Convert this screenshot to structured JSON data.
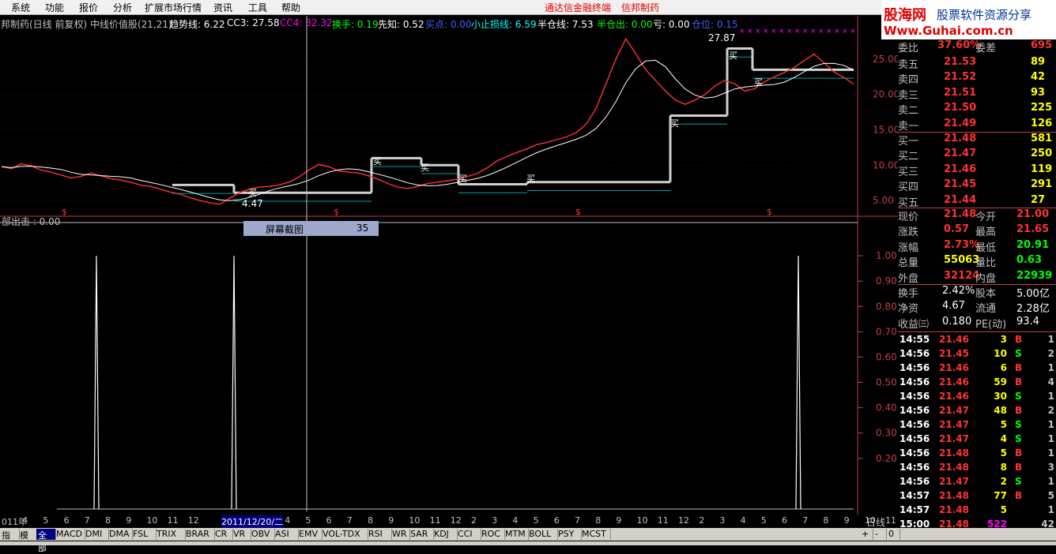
{
  "menu": [
    "系统",
    "功能",
    "报价",
    "分析",
    "扩展市场行情",
    "资讯",
    "工具",
    "帮助"
  ],
  "banner": [
    "通达信金融终端",
    "信邦制药"
  ],
  "logo": {
    "brand": "股海网",
    "tagline": "股票软件资源分享",
    "url": "Www.Guhai.com.cn"
  },
  "info": {
    "stock": "邦制药(日线 前复权) 中线价值股(21,21)",
    "trend": "趋势线: 6.22",
    "cc3": "CC3: 27.58",
    "cc4": "CC4: 32.32",
    "turnover": "换手: 0.19",
    "xianzhi": "先知: 0.52",
    "buy": "买点: 0.00",
    "stoploss": "小止损线: 6.59",
    "halfpos": "半仓线: 7.53",
    "halfout": "半仓出: 0.00",
    "loss": "亏: 0.00",
    "position": "仓位: 0.15"
  },
  "price_axis": {
    "ticks": [
      "25.00",
      "20.00",
      "15.00",
      "10.00",
      "5.00"
    ],
    "values": [
      25,
      20,
      15,
      10,
      5
    ]
  },
  "ind_axis": {
    "ticks": [
      "1.00",
      "0.90",
      "0.80",
      "0.70",
      "0.60",
      "0.50",
      "0.40",
      "0.30",
      "0.20"
    ]
  },
  "annotations": {
    "high": "27.87",
    "low": "4.47",
    "buy_label": "买",
    "dollar": "$"
  },
  "indicator_title": "部出击 : 0.00",
  "popup": {
    "label": "屏幕截图",
    "value": "35"
  },
  "colors": {
    "up": "#ff3232",
    "down": "#00ffff",
    "white": "#ffffff",
    "yellow": "#ffff00",
    "green": "#00ff00",
    "magenta": "#ff00ff",
    "blue": "#4060ff"
  },
  "panel": {
    "weibi": {
      "label": "委比",
      "value": "37.60%",
      "label2": "委差",
      "value2": "695"
    },
    "asks": [
      {
        "label": "卖五",
        "price": "21.53",
        "vol": "89"
      },
      {
        "label": "卖四",
        "price": "21.52",
        "vol": "42"
      },
      {
        "label": "卖三",
        "price": "21.51",
        "vol": "93"
      },
      {
        "label": "卖二",
        "price": "21.50",
        "vol": "225"
      },
      {
        "label": "卖一",
        "price": "21.49",
        "vol": "126"
      }
    ],
    "bids": [
      {
        "label": "买一",
        "price": "21.48",
        "vol": "581"
      },
      {
        "label": "买二",
        "price": "21.47",
        "vol": "250"
      },
      {
        "label": "买三",
        "price": "21.46",
        "vol": "119"
      },
      {
        "label": "买四",
        "price": "21.45",
        "vol": "291"
      },
      {
        "label": "买五",
        "price": "21.44",
        "vol": "27"
      }
    ],
    "stats": [
      {
        "l1": "现价",
        "v1": "21.48",
        "l2": "今开",
        "v2": "21.00"
      },
      {
        "l1": "涨跌",
        "v1": "0.57",
        "l2": "最高",
        "v2": "21.65"
      },
      {
        "l1": "涨幅",
        "v1": "2.73%",
        "l2": "最低",
        "v2": "20.91"
      },
      {
        "l1": "总量",
        "v1": "55063",
        "l2": "量比",
        "v2": "0.63"
      },
      {
        "l1": "外盘",
        "v1": "32124",
        "l2": "内盘",
        "v2": "22939"
      }
    ],
    "fund": [
      {
        "l1": "换手",
        "v1": "2.42%",
        "l2": "股本",
        "v2": "5.00亿"
      },
      {
        "l1": "净资",
        "v1": "4.67",
        "l2": "流通",
        "v2": "2.28亿"
      },
      {
        "l1": "收益㈢",
        "v1": "0.180",
        "l2": "PE(动)",
        "v2": "93.4"
      }
    ],
    "ticks": [
      {
        "t": "14:55",
        "p": "21.46",
        "v": "3",
        "d": "B",
        "n": "1"
      },
      {
        "t": "14:56",
        "p": "21.45",
        "v": "10",
        "d": "S",
        "n": "2"
      },
      {
        "t": "14:56",
        "p": "21.46",
        "v": "6",
        "d": "B",
        "n": "1"
      },
      {
        "t": "14:56",
        "p": "21.46",
        "v": "59",
        "d": "B",
        "n": "4"
      },
      {
        "t": "14:56",
        "p": "21.46",
        "v": "30",
        "d": "S",
        "n": "1"
      },
      {
        "t": "14:56",
        "p": "21.47",
        "v": "48",
        "d": "B",
        "n": "2"
      },
      {
        "t": "14:56",
        "p": "21.47",
        "v": "5",
        "d": "S",
        "n": "1"
      },
      {
        "t": "14:56",
        "p": "21.47",
        "v": "4",
        "d": "S",
        "n": "1"
      },
      {
        "t": "14:56",
        "p": "21.48",
        "v": "5",
        "d": "B",
        "n": "1"
      },
      {
        "t": "14:56",
        "p": "21.48",
        "v": "8",
        "d": "B",
        "n": "3"
      },
      {
        "t": "14:56",
        "p": "21.47",
        "v": "2",
        "d": "S",
        "n": "1"
      },
      {
        "t": "14:57",
        "p": "21.48",
        "v": "77",
        "d": "B",
        "n": "5"
      },
      {
        "t": "14:57",
        "p": "21.48",
        "v": "5",
        "d": "",
        "n": "1"
      },
      {
        "t": "15:00",
        "p": "21.48",
        "v": "522",
        "d": "",
        "n": "42"
      }
    ]
  },
  "xaxis": {
    "labels": [
      "011年",
      "4",
      "5",
      "6",
      "7",
      "8",
      "9",
      "10",
      "11",
      "12",
      "2011/12/20/二",
      "4",
      "5",
      "6",
      "7",
      "8",
      "9",
      "10",
      "11",
      "12",
      "2",
      "3",
      "4",
      "5",
      "6",
      "7",
      "8",
      "9",
      "10",
      "11",
      "12",
      "2",
      "3",
      "4",
      "5",
      "6",
      "7",
      "8",
      "9",
      "10",
      "11"
    ],
    "period": "日线"
  },
  "tabs": [
    "指标",
    "模板",
    "全部",
    "MACD",
    "DMI",
    "DMA",
    "FSL",
    "TRIX",
    "BRAR",
    "CR",
    "VR",
    "OBV",
    "ASI",
    "EMV",
    "VOL-TDX",
    "RSI",
    "WR",
    "SAR",
    "KDJ",
    "CCI",
    "ROC",
    "MTM",
    "BOLL",
    "PSY",
    "MCST"
  ],
  "active_tab": "全部",
  "controls": [
    "+",
    "-",
    "0"
  ],
  "chart_data": {
    "type": "line",
    "ylim": [
      3,
      28
    ],
    "price": [
      9.8,
      9.5,
      10.2,
      9.9,
      9.3,
      9.0,
      8.6,
      8.2,
      8.4,
      8.9,
      8.5,
      8.1,
      7.9,
      7.6,
      7.2,
      7.0,
      6.6,
      6.2,
      5.9,
      5.4,
      5.0,
      4.7,
      4.47,
      5.3,
      6.1,
      6.6,
      6.9,
      7.0,
      7.2,
      7.6,
      8.3,
      9.3,
      10.1,
      9.8,
      9.2,
      9.0,
      8.9,
      8.5,
      8.0,
      7.4,
      6.9,
      6.7,
      7.0,
      7.4,
      7.6,
      7.8,
      8.0,
      8.4,
      8.8,
      9.6,
      10.6,
      11.2,
      11.8,
      12.3,
      12.9,
      13.2,
      13.6,
      14.0,
      14.6,
      15.8,
      18.0,
      21.5,
      25.0,
      27.87,
      25.8,
      23.5,
      22.0,
      20.5,
      19.2,
      18.6,
      19.2,
      20.0,
      21.2,
      22.0,
      21.5,
      20.5,
      20.8,
      21.8,
      22.5,
      23.1,
      23.8,
      24.8,
      25.7,
      24.5,
      23.2,
      22.4,
      21.48
    ],
    "trend_step": [
      {
        "x0": 218,
        "x1": 296,
        "y": 7.2
      },
      {
        "x0": 296,
        "x1": 470,
        "y": 6.1
      },
      {
        "x0": 470,
        "x1": 533,
        "y": 11.0
      },
      {
        "x0": 533,
        "x1": 580,
        "y": 10.0
      },
      {
        "x0": 580,
        "x1": 667,
        "y": 7.3
      },
      {
        "x0": 667,
        "x1": 848,
        "y": 7.6
      },
      {
        "x0": 848,
        "x1": 920,
        "y": 17.0
      },
      {
        "x0": 920,
        "x1": 952,
        "y": 26.5
      },
      {
        "x0": 952,
        "x1": 1080,
        "y": 23.5
      }
    ],
    "indicator": {
      "spikes": [
        122,
        296,
        1010
      ],
      "ylim": [
        0,
        1.1
      ]
    }
  }
}
